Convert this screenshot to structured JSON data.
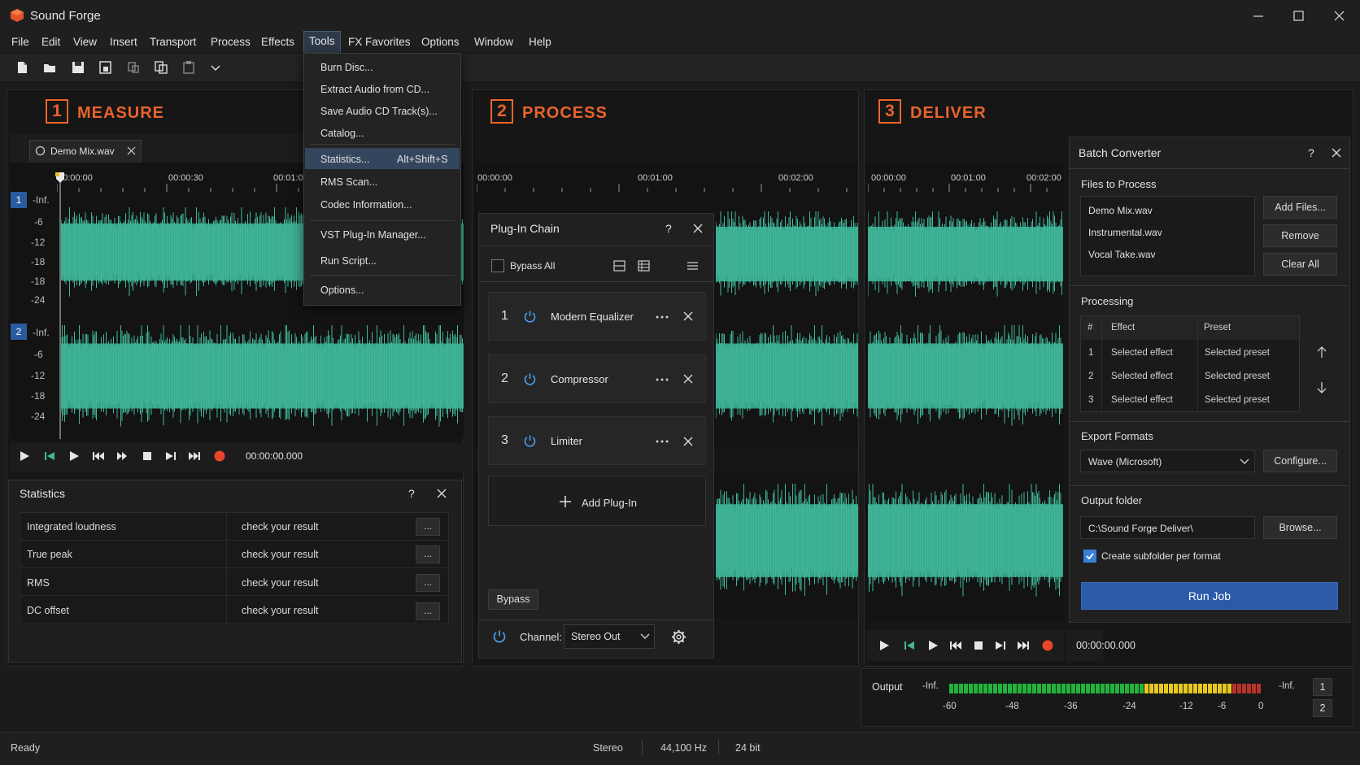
{
  "app": {
    "title": "Sound Forge"
  },
  "menu": [
    "File",
    "Edit",
    "View",
    "Insert",
    "Transport",
    "Process",
    "Effects",
    "Tools",
    "FX Favorites",
    "Options",
    "Window",
    "Help"
  ],
  "tools_menu": {
    "items": [
      "Burn Disc...",
      "Extract Audio from CD...",
      "Save Audio CD Track(s)...",
      "Catalog...",
      "Statistics...",
      "RMS Scan...",
      "Codec Information...",
      "VST Plug-In Manager...",
      "Run Script...",
      "Options..."
    ],
    "statistics_shortcut": "Alt+Shift+S"
  },
  "sections": [
    {
      "number": "1",
      "title": "MEASURE"
    },
    {
      "number": "2",
      "title": "PROCESS"
    },
    {
      "number": "3",
      "title": "DELIVER"
    }
  ],
  "measure": {
    "file_tab": "Demo Mix.wav",
    "ruler": [
      "00:00:00",
      "00:00:30",
      "00:01:0"
    ],
    "db_labels": [
      "-Inf.",
      "-6",
      "-12",
      "-18",
      "-18",
      "-24"
    ],
    "db_labels_2": [
      "-Inf.",
      "-6",
      "-12",
      "-18",
      "-24"
    ],
    "channels": [
      "1",
      "2"
    ],
    "time": "00:00:00.000"
  },
  "process": {
    "ruler": [
      "00:00:00",
      "00:01:00",
      "00:02:00"
    ]
  },
  "deliver": {
    "ruler": [
      "00:00:00",
      "00:01:00",
      "00:02:00"
    ],
    "time": "00:00:00.000"
  },
  "statistics": {
    "title": "Statistics",
    "help": "?",
    "rows": [
      {
        "label": "Integrated loudness",
        "value": "check your result",
        "btn": "..."
      },
      {
        "label": "True peak",
        "value": "check your result",
        "btn": "..."
      },
      {
        "label": "RMS",
        "value": "check your result",
        "btn": "..."
      },
      {
        "label": "DC offset",
        "value": "check your result",
        "btn": "..."
      }
    ]
  },
  "plugin_chain": {
    "title": "Plug-In Chain",
    "help": "?",
    "bypass_all": "Bypass All",
    "plugins": [
      {
        "num": "1",
        "name": "Modern Equalizer"
      },
      {
        "num": "2",
        "name": "Compressor"
      },
      {
        "num": "3",
        "name": "Limiter"
      }
    ],
    "add_plugin": "Add Plug-In",
    "bypass": "Bypass",
    "channel_label": "Channel:",
    "channel_value": "Stereo Out"
  },
  "batch": {
    "title": "Batch Converter",
    "help": "?",
    "files_label": "Files to Process",
    "files": [
      "Demo Mix.wav",
      "Instrumental.wav",
      "Vocal Take.wav"
    ],
    "add_files": "Add Files...",
    "remove": "Remove",
    "clear_all": "Clear All",
    "processing_label": "Processing",
    "columns": [
      "#",
      "Effect",
      "Preset"
    ],
    "rows": [
      {
        "n": "1",
        "effect": "Selected effect",
        "preset": "Selected preset"
      },
      {
        "n": "2",
        "effect": "Selected effect",
        "preset": "Selected preset"
      },
      {
        "n": "3",
        "effect": "Selected effect",
        "preset": "Selected preset"
      }
    ],
    "export_label": "Export Formats",
    "export_value": "Wave (Microsoft)",
    "configure": "Configure...",
    "output_label": "Output folder",
    "output_value": "C:\\Sound Forge Deliver\\",
    "browse": "Browse...",
    "subfolder": "Create subfolder per format",
    "run": "Run Job"
  },
  "meter": {
    "label": "Output",
    "left_inf": "-Inf.",
    "right_inf": "-Inf.",
    "scale": [
      "-60",
      "-48",
      "-36",
      "-24",
      "-12",
      "-6",
      "0"
    ],
    "channels": [
      "1",
      "2"
    ]
  },
  "status": {
    "ready": "Ready",
    "channels": "Stereo",
    "rate": "44,100 Hz",
    "bits": "24 bit"
  },
  "colors": {
    "accent": "#e8642c",
    "waveform": "#3fb89a",
    "run_button": "#2a5aa8",
    "meter_green": "#22b33c",
    "meter_yellow": "#e6c81e",
    "meter_red": "#b8322a"
  }
}
